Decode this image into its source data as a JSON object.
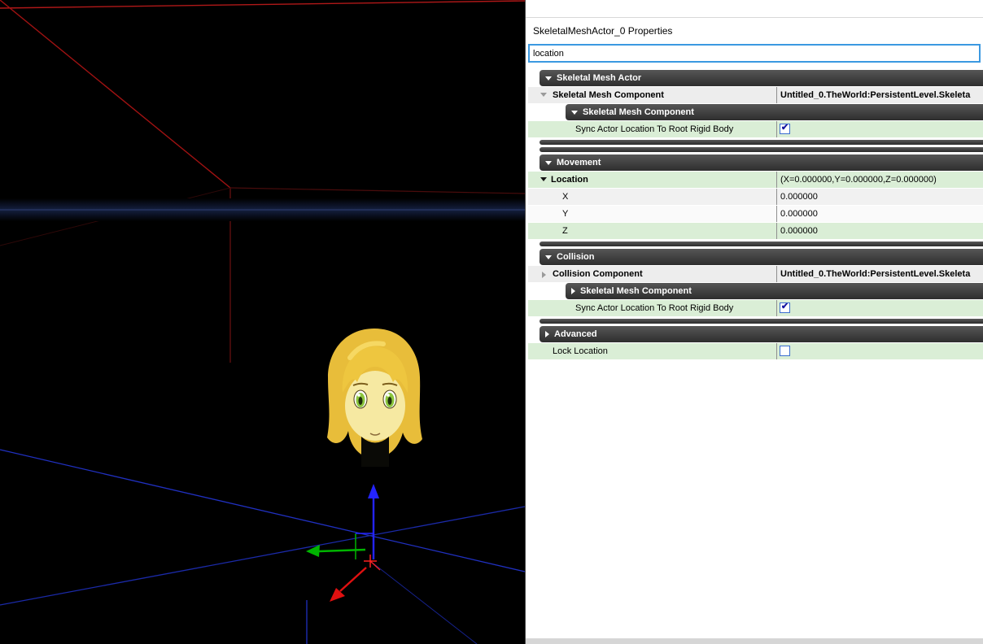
{
  "window": {
    "title": "SkeletalMeshActor_0 Properties"
  },
  "search": {
    "value": "location"
  },
  "sections": {
    "skeletal_mesh_actor": {
      "title": "Skeletal Mesh Actor",
      "expanded": true,
      "component": {
        "label": "Skeletal Mesh Component",
        "value": "Untitled_0.TheWorld:PersistentLevel.Skeleta"
      },
      "subcomponent_header": "Skeletal Mesh Component",
      "subcomponent_expanded": true,
      "sync": {
        "label": "Sync Actor Location To Root Rigid Body",
        "checked": true
      }
    },
    "movement": {
      "title": "Movement",
      "expanded": true,
      "location": {
        "label": "Location",
        "value": "(X=0.000000,Y=0.000000,Z=0.000000)",
        "expanded": true
      },
      "x": {
        "label": "X",
        "value": "0.000000"
      },
      "y": {
        "label": "Y",
        "value": "0.000000"
      },
      "z": {
        "label": "Z",
        "value": "0.000000"
      }
    },
    "collision": {
      "title": "Collision",
      "expanded": true,
      "component": {
        "label": "Collision Component",
        "value": "Untitled_0.TheWorld:PersistentLevel.Skeleta"
      },
      "subcomponent_header": "Skeletal Mesh Component",
      "subcomponent_expanded": false,
      "sync": {
        "label": "Sync Actor Location To Root Rigid Body",
        "checked": true
      }
    },
    "advanced": {
      "title": "Advanced",
      "expanded": false,
      "lock": {
        "label": "Lock Location",
        "checked": false
      }
    }
  },
  "colors": {
    "search_match_row_green": "#daeed6",
    "section_header_dark": "#3a3a3a",
    "search_border_blue": "#3b99e1",
    "gizmo_x_red": "#e01010",
    "gizmo_y_green": "#00b400",
    "gizmo_z_blue": "#2424ff",
    "grid_blue": "#2030c0",
    "brush_red": "#b01818",
    "viewport_background": "#000000"
  }
}
